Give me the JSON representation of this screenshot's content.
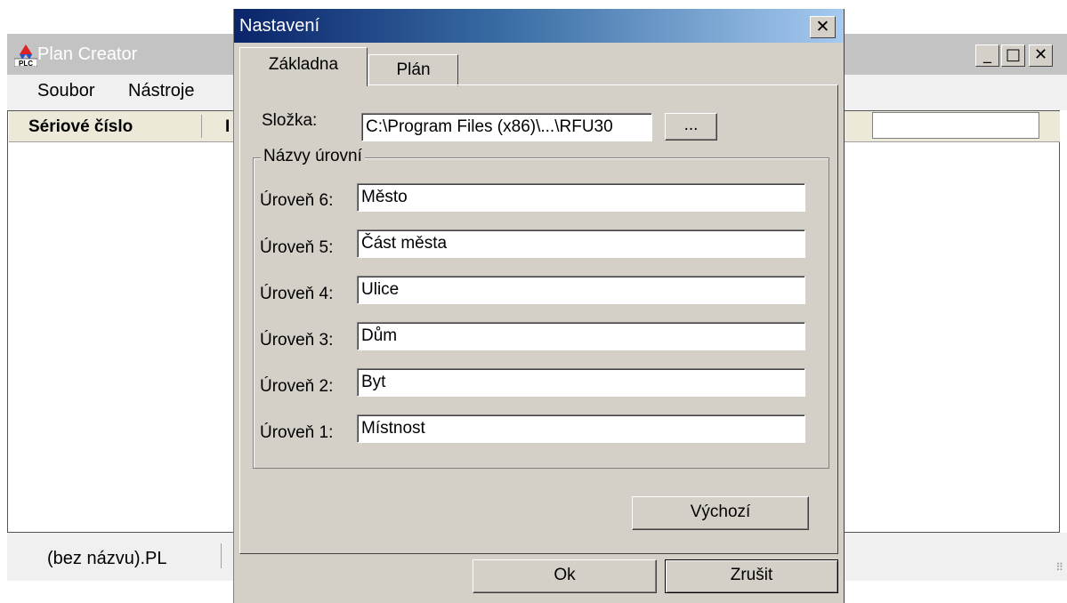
{
  "main_window": {
    "title": "Plan Creator",
    "app_icon_text": "PLC",
    "controls": {
      "minimize": "_",
      "maximize": "□",
      "close": "✕"
    },
    "menu": [
      "Soubor",
      "Nástroje"
    ],
    "columns": [
      "Sériové číslo",
      "I"
    ],
    "status": "(bez názvu).PL"
  },
  "dialog": {
    "title": "Nastavení",
    "close": "✕",
    "tabs": [
      "Základna",
      "Plán"
    ],
    "folder_label": "Složka:",
    "folder_value": "C:\\Program Files (x86)\\...\\RFU30",
    "browse_label": "...",
    "group_title": "Názvy úrovní",
    "levels": [
      {
        "label": "Úroveň 6:",
        "value": "Město"
      },
      {
        "label": "Úroveň 5:",
        "value": "Část města"
      },
      {
        "label": "Úroveň 4:",
        "value": "Ulice"
      },
      {
        "label": "Úroveň 3:",
        "value": "Dům"
      },
      {
        "label": "Úroveň 2:",
        "value": "Byt"
      },
      {
        "label": "Úroveň 1:",
        "value": "Místnost"
      }
    ],
    "default_button": "Výchozí",
    "ok_button": "Ok",
    "cancel_button": "Zrušit"
  },
  "colors": {
    "title_gradient_start": "#0a246a",
    "title_gradient_end": "#a6caf0",
    "face": "#d4d0c8"
  }
}
